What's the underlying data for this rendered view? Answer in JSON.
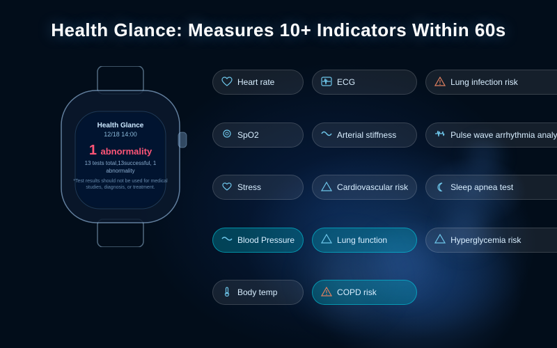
{
  "title": "Health Glance: Measures 10+ Indicators Within 60s",
  "watch": {
    "screen_title": "Health Glance",
    "screen_date": "12/18 14:00",
    "abnormality_label": "abnormality",
    "abnormality_count": "1",
    "abnormality_prefix": "1",
    "tests_info": "13 tests total,13successful, 1 abnormality",
    "disclaimer": "*Test results should not be used for medical studies, diagnosis, or treatment."
  },
  "indicators": [
    {
      "id": "heart-rate",
      "icon": "♡",
      "label": "Heart rate",
      "highlighted": false,
      "col": 1,
      "row": 1
    },
    {
      "id": "ecg",
      "icon": "📋",
      "label": "ECG",
      "highlighted": false,
      "col": 2,
      "row": 1
    },
    {
      "id": "lung-infection",
      "icon": "⚠",
      "label": "Lung infection risk",
      "highlighted": false,
      "col": 3,
      "row": 1
    },
    {
      "id": "spo2",
      "icon": "◎",
      "label": "SpO2",
      "highlighted": false,
      "col": 1,
      "row": 2
    },
    {
      "id": "arterial-stiffness",
      "icon": "〜",
      "label": "Arterial stiffness",
      "highlighted": false,
      "col": 2,
      "row": 2
    },
    {
      "id": "pulse-wave",
      "icon": "〜",
      "label": "Pulse wave arrhythmia analysis",
      "highlighted": false,
      "col": 3,
      "row": 2
    },
    {
      "id": "stress",
      "icon": "♡",
      "label": "Stress",
      "highlighted": false,
      "col": 1,
      "row": 3
    },
    {
      "id": "cardiovascular",
      "icon": "⚠",
      "label": "Cardiovascular risk",
      "highlighted": false,
      "col": 2,
      "row": 3
    },
    {
      "id": "sleep-apnea",
      "icon": "☽",
      "label": "Sleep apnea test",
      "highlighted": false,
      "col": 3,
      "row": 3
    },
    {
      "id": "blood-pressure",
      "icon": "〰",
      "label": "Blood Pressure",
      "highlighted": true,
      "col": 1,
      "row": 4
    },
    {
      "id": "lung-function",
      "icon": "⚠",
      "label": "Lung function",
      "highlighted": true,
      "col": 2,
      "row": 4
    },
    {
      "id": "hyperglycemia",
      "icon": "◈",
      "label": "Hyperglycemia risk",
      "highlighted": false,
      "col": 3,
      "row": 4
    },
    {
      "id": "body-temp",
      "icon": "♨",
      "label": "Body temp",
      "highlighted": false,
      "col": 1,
      "row": 5
    },
    {
      "id": "copd-risk",
      "icon": "⚠",
      "label": "COPD risk",
      "highlighted": true,
      "col": 2,
      "row": 5
    }
  ]
}
